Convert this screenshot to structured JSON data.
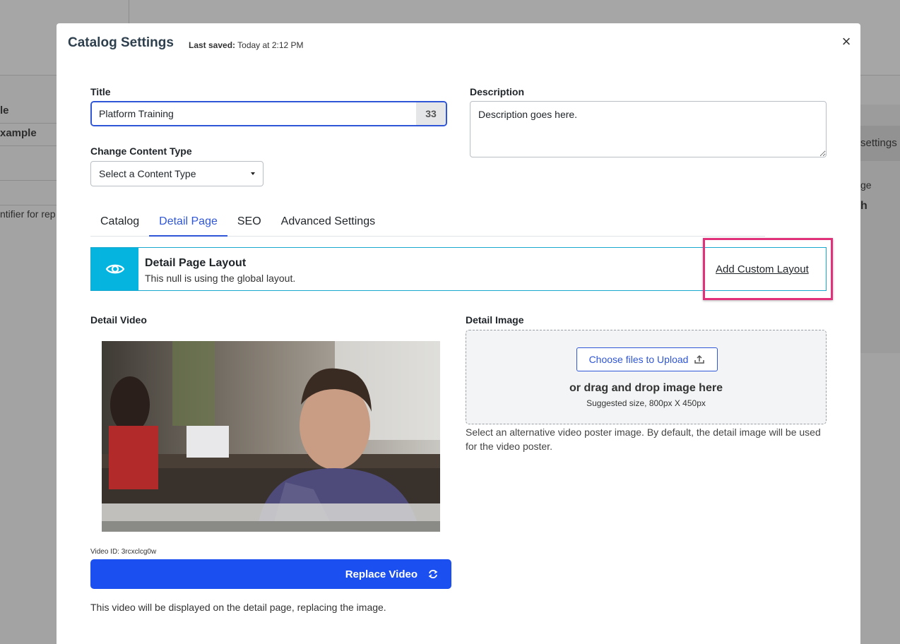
{
  "background": {
    "left_texts": [
      "le",
      "xample",
      "ntifier for rep"
    ],
    "right_texts": [
      "settings",
      "ge",
      "h"
    ]
  },
  "modal": {
    "title": "Catalog Settings",
    "last_saved_label": "Last saved:",
    "last_saved_value": "Today at 2:12 PM",
    "close_icon": "×"
  },
  "form": {
    "title_label": "Title",
    "title_value": "Platform Training",
    "title_char_count": "33",
    "description_label": "Description",
    "description_value": "Description goes here.",
    "content_type_label": "Change Content Type",
    "content_type_selected": "Select a Content Type"
  },
  "tabs": [
    {
      "label": "Catalog",
      "active": false
    },
    {
      "label": "Detail Page",
      "active": true
    },
    {
      "label": "SEO",
      "active": false
    },
    {
      "label": "Advanced Settings",
      "active": false
    }
  ],
  "layout_banner": {
    "icon": "eye-icon",
    "title": "Detail Page Layout",
    "subtitle": "This null is using the global layout.",
    "action_label": "Add Custom Layout"
  },
  "detail_video": {
    "label": "Detail Video",
    "video_id": "Video ID: 3rcxclcg0w",
    "replace_label": "Replace Video",
    "replace_icon": "refresh-icon",
    "help_text": "This video will be displayed on the detail page, replacing the image."
  },
  "detail_image": {
    "label": "Detail Image",
    "upload_label": "Choose files to Upload",
    "upload_icon": "upload-icon",
    "drop_text": "or drag and drop image here",
    "size_hint": "Suggested size, 800px X 450px",
    "help_text": "Select an alternative video poster image. By default, the detail image will be used for the video poster."
  },
  "colors": {
    "accent": "#2f56d6",
    "primary_button": "#1c4ff0",
    "banner_icon_bg": "#05b5e0",
    "highlight": "#e0317a"
  }
}
